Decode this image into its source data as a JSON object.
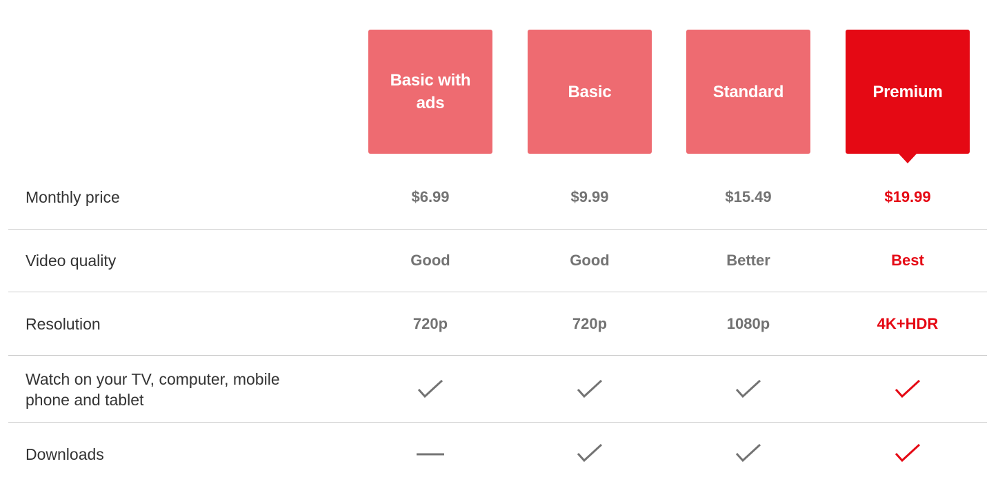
{
  "colors": {
    "accent": "#e50914",
    "unselected_card": "#ee6b71",
    "value_text": "#737373",
    "label_text": "#333333",
    "divider": "#cccccc"
  },
  "plans": [
    {
      "name": "Basic with ads",
      "selected": false
    },
    {
      "name": "Basic",
      "selected": false
    },
    {
      "name": "Standard",
      "selected": false
    },
    {
      "name": "Premium",
      "selected": true
    }
  ],
  "rows": [
    {
      "label": "Monthly price",
      "values": [
        "$6.99",
        "$9.99",
        "$15.49",
        "$19.99"
      ]
    },
    {
      "label": "Video quality",
      "values": [
        "Good",
        "Good",
        "Better",
        "Best"
      ]
    },
    {
      "label": "Resolution",
      "values": [
        "720p",
        "720p",
        "1080p",
        "4K+HDR"
      ]
    },
    {
      "label": "Watch on your TV, computer, mobile phone and tablet",
      "values": [
        "check-icon",
        "check-icon",
        "check-icon",
        "check-icon"
      ]
    },
    {
      "label": "Downloads",
      "values": [
        "dash-icon",
        "check-icon",
        "check-icon",
        "check-icon"
      ]
    }
  ]
}
